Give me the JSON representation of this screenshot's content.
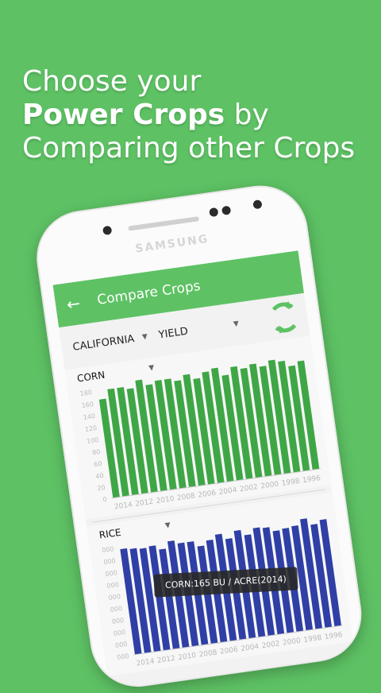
{
  "promo": {
    "line1": "Choose your",
    "line2_bold": "Power Crops",
    "line2_rest": " by",
    "line3": "Comparing other Crops"
  },
  "device": {
    "brand": "SAMSUNG"
  },
  "app": {
    "title": "Compare Crops",
    "back_icon": "arrow-left-icon",
    "filters": {
      "state": "CALIFORNIA",
      "metric": "YIELD"
    },
    "refresh_icon": "refresh-icon"
  },
  "colors": {
    "accent": "#5ec264",
    "corn": "#3fa646",
    "rice": "#2f3fa5"
  },
  "chart_data": [
    {
      "type": "bar",
      "title": "CORN",
      "yticks": [
        0,
        20,
        40,
        60,
        80,
        100,
        120,
        140,
        160,
        180
      ],
      "ylim": [
        0,
        190
      ],
      "x_tick_labels": [
        "2014",
        "2012",
        "2010",
        "2008",
        "2006",
        "2004",
        "2002",
        "2000",
        "1998",
        "1996"
      ],
      "values": [
        165,
        180,
        180,
        176,
        188,
        178,
        183,
        183,
        178,
        186,
        177,
        186,
        190,
        176,
        188,
        183,
        188,
        182,
        190,
        186,
        176,
        182
      ]
    },
    {
      "type": "bar",
      "title": "RICE",
      "yticks": [
        "000",
        "000",
        "000",
        "000",
        "000",
        "000",
        "000",
        "000",
        "000",
        "000"
      ],
      "ylim": [
        0,
        100
      ],
      "x_tick_labels": [
        "2014",
        "2012",
        "2010",
        "2008",
        "2006",
        "2004",
        "2002",
        "2000",
        "1998",
        "1996"
      ],
      "values": [
        93,
        92,
        91,
        92,
        88,
        94,
        91,
        91,
        86,
        90,
        94,
        89,
        95,
        90,
        95,
        94,
        90,
        91,
        92,
        97,
        91,
        94
      ]
    }
  ],
  "tooltip": "CORN:165 BU / ACRE(2014)"
}
